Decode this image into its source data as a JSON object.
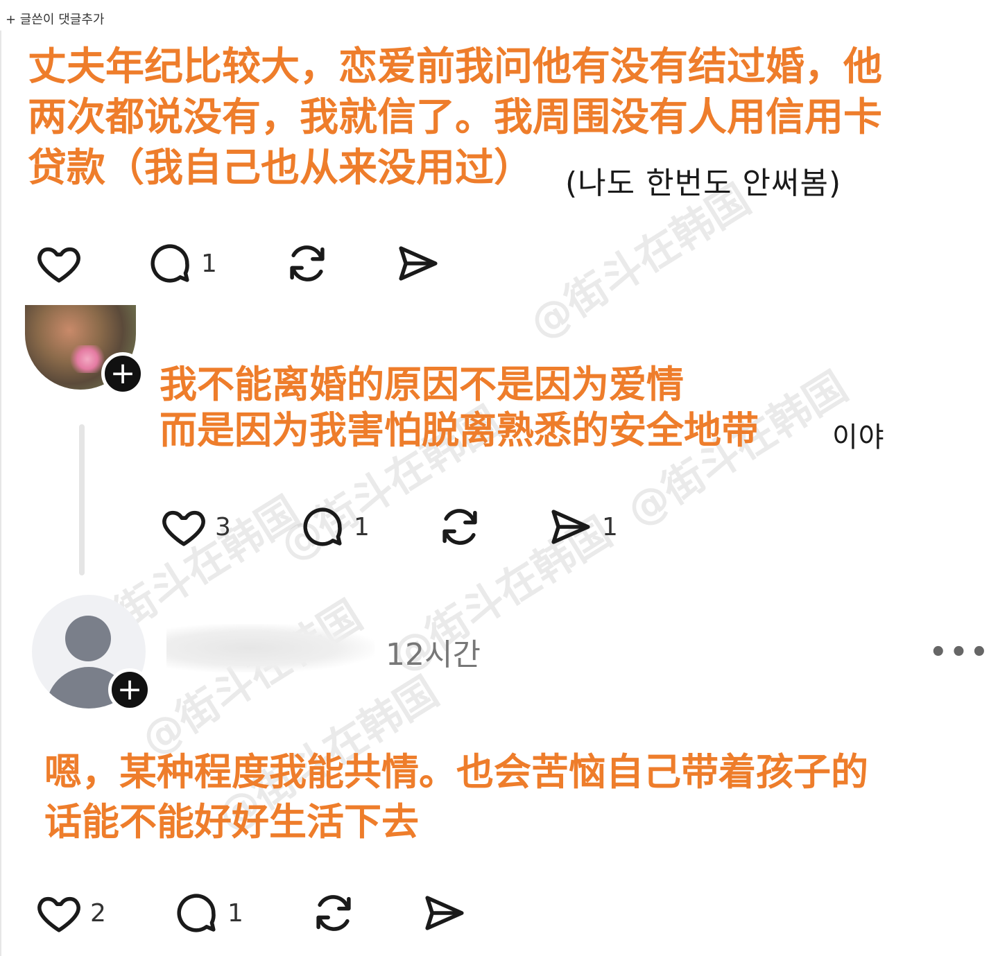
{
  "header": {
    "breadcrumb": "+ 글쓴이 댓글추가"
  },
  "post1": {
    "korean_visible": "(나도 한번도 안써봄)",
    "overlay": "丈夫年纪比较大，恋爱前我问他有没有结过婚，他\n两次都说没有，我就信了。我周围没有人用信用卡\n贷款（我自己也从来没用过）",
    "actions": {
      "like_count": "",
      "comment_count": "1",
      "repost_count": "",
      "share_count": ""
    }
  },
  "post2": {
    "korean_visible": "이야",
    "overlay": "我不能离婚的原因不是因为爱情\n而是因为我害怕脱离熟悉的安全地带",
    "actions": {
      "like_count": "3",
      "comment_count": "1",
      "repost_count": "",
      "share_count": "1"
    }
  },
  "post3": {
    "timestamp": "12시간",
    "more": "•••",
    "overlay": "嗯，某种程度我能共情。也会苦恼自己带着孩子的\n话能不能好好生活下去",
    "actions": {
      "like_count": "2",
      "comment_count": "1",
      "repost_count": "",
      "share_count": ""
    }
  },
  "badge": {
    "plus": "+"
  },
  "watermark": "@街斗在韩国",
  "colors": {
    "overlay": "#ee7d2b",
    "icon": "#1a1a1a",
    "thread_line": "#e5e5e5"
  },
  "icons": [
    "heart-icon",
    "comment-icon",
    "repost-icon",
    "share-icon",
    "plus-icon",
    "more-icon"
  ]
}
